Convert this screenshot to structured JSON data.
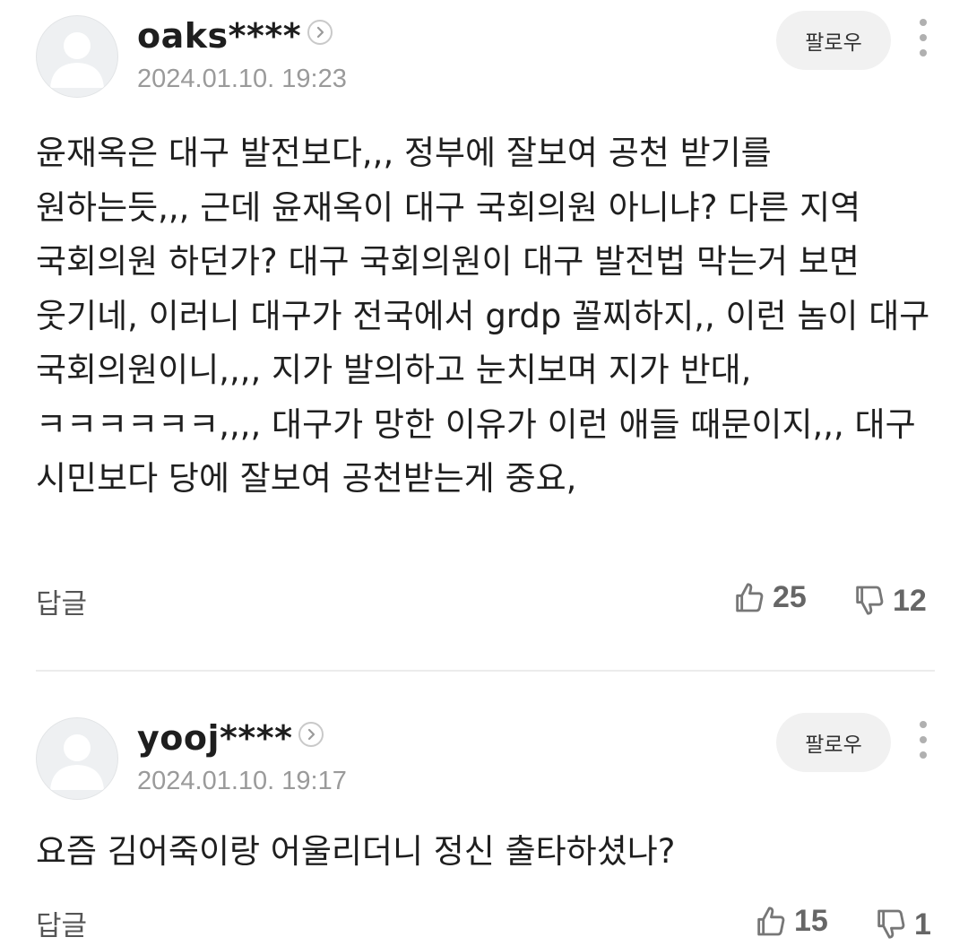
{
  "comments": [
    {
      "username": "oaks****",
      "date": "2024.01.10. 19:23",
      "follow_label": "팔로우",
      "text": "윤재옥은 대구 발전보다,,, 정부에 잘보여 공천 받기를 원하는듯,,, 근데 윤재옥이 대구 국회의원 아니냐? 다른 지역 국회의원 하던가? 대구 국회의원이 대구 발전법 막는거 보면 웃기네, 이러니 대구가 전국에서 grdp 꼴찌하지,, 이런 놈이 대구 국회의원이니,,,, 지가 발의하고 눈치보며 지가 반대, ㅋㅋㅋㅋㅋㅋ,,,, 대구가 망한 이유가 이런 애들 때문이지,,, 대구 시민보다 당에 잘보여 공천받는게 중요,",
      "reply_label": "답글",
      "likes": "25",
      "dislikes": "12"
    },
    {
      "username": "yooj****",
      "date": "2024.01.10. 19:17",
      "follow_label": "팔로우",
      "text": "요즘 김어죽이랑 어울리더니 정신 출타하셨나?",
      "reply_label": "답글",
      "likes": "15",
      "dislikes": "1"
    }
  ],
  "icons": {
    "avatar": "default-avatar-icon",
    "profile_link": "chevron-right-icon",
    "more": "more-vertical-icon",
    "like": "thumbs-up-icon",
    "dislike": "thumbs-down-icon"
  }
}
